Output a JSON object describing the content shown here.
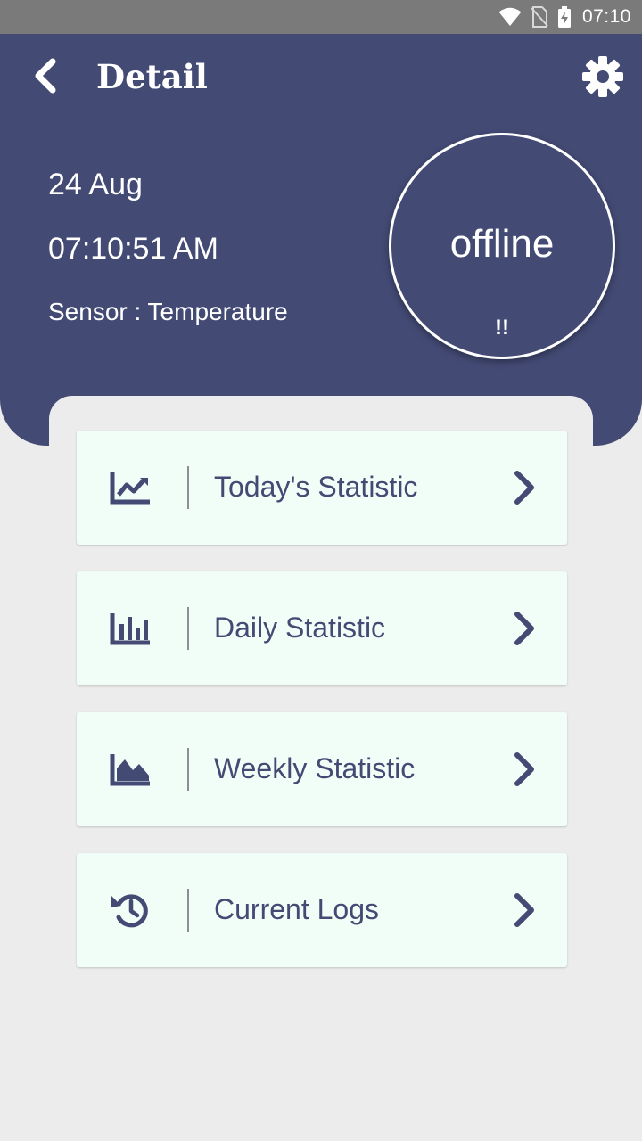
{
  "status_bar": {
    "time": "07:10",
    "icons": [
      "wifi-icon",
      "no-sim-icon",
      "battery-charging-icon"
    ]
  },
  "header": {
    "back_icon": "chevron-left-icon",
    "title": "Detail",
    "settings_icon": "gear-icon",
    "date": "24 Aug",
    "time": "07:10:51 AM",
    "sensor": "Sensor : Temperature",
    "status": "offline",
    "status_sub": "!!"
  },
  "menu": {
    "items": [
      {
        "label": "Today's Statistic",
        "icon": "line-chart-icon"
      },
      {
        "label": "Daily Statistic",
        "icon": "bar-chart-icon"
      },
      {
        "label": "Weekly Statistic",
        "icon": "area-chart-icon"
      },
      {
        "label": "Current Logs",
        "icon": "history-icon"
      }
    ],
    "chevron_icon": "chevron-right-icon"
  },
  "colors": {
    "primary": "#434a74",
    "card_background": "#f1fdf7",
    "page_background": "#ececec",
    "status_bar": "#7a7a7a"
  }
}
